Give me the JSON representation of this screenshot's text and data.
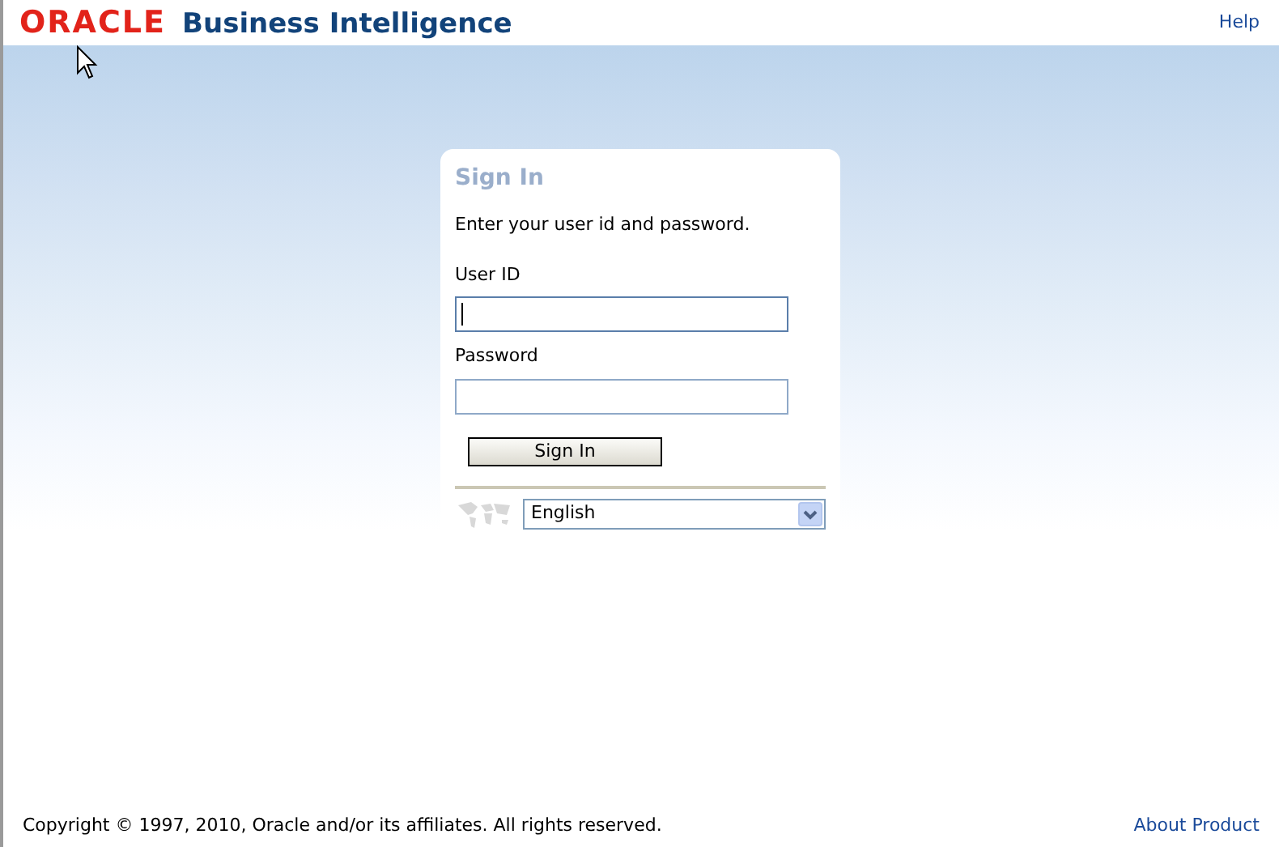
{
  "header": {
    "logo": "ORACLE",
    "product": "Business Intelligence",
    "help_link": "Help"
  },
  "sign_in": {
    "title": "Sign In",
    "instructions": "Enter your user id and password.",
    "fields": [
      {
        "label": "User ID",
        "focused": true
      },
      {
        "label": "Password",
        "focused": false
      }
    ],
    "button": "Sign In",
    "language": "English"
  },
  "footer": {
    "copyright": "Copyright © 1997, 2010, Oracle and/or its affiliates. All rights reserved.",
    "about_link": "About Product"
  }
}
